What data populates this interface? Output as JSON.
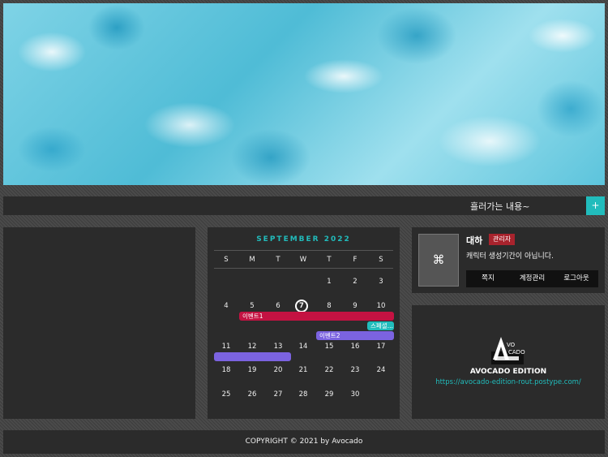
{
  "marquee": {
    "text": "흘러가는 내용~",
    "button": "+"
  },
  "calendar": {
    "title": "SEPTEMBER 2022",
    "weekdays": [
      "S",
      "M",
      "T",
      "W",
      "T",
      "F",
      "S"
    ],
    "weeks": [
      [
        "",
        "",
        "",
        "",
        "1",
        "2",
        "3"
      ],
      [
        "4",
        "5",
        "6",
        "7",
        "8",
        "9",
        "10"
      ],
      [
        "11",
        "12",
        "13",
        "14",
        "15",
        "16",
        "17"
      ],
      [
        "18",
        "19",
        "20",
        "21",
        "22",
        "23",
        "24"
      ],
      [
        "25",
        "26",
        "27",
        "28",
        "29",
        "30",
        ""
      ]
    ],
    "today": "7",
    "events": [
      {
        "label": "이벤트1",
        "color": "#c41242"
      },
      {
        "label": "스페셜...",
        "color": "#21bcbc"
      },
      {
        "label": "이벤트2",
        "color": "#7b63e0"
      },
      {
        "label": "",
        "color": "#7b63e0"
      }
    ]
  },
  "profile": {
    "avatar_icon": "command-icon",
    "avatar_glyph": "⌘",
    "name": "대하",
    "role": "관리자",
    "status": "캐릭터 생성기간이 아닙니다.",
    "menu": [
      "쪽지",
      "계정관리",
      "로그아웃"
    ]
  },
  "logo": {
    "mark_text": "AVO CADO",
    "title": "AVOCADO EDITION",
    "url": "https://avocado-edition-rout.postype.com/"
  },
  "footer": {
    "text": "COPYRIGHT © 2021 by Avocado"
  },
  "colors": {
    "accent": "#21bcbc",
    "badge": "#a8232d",
    "panel": "#2b2b2b"
  }
}
